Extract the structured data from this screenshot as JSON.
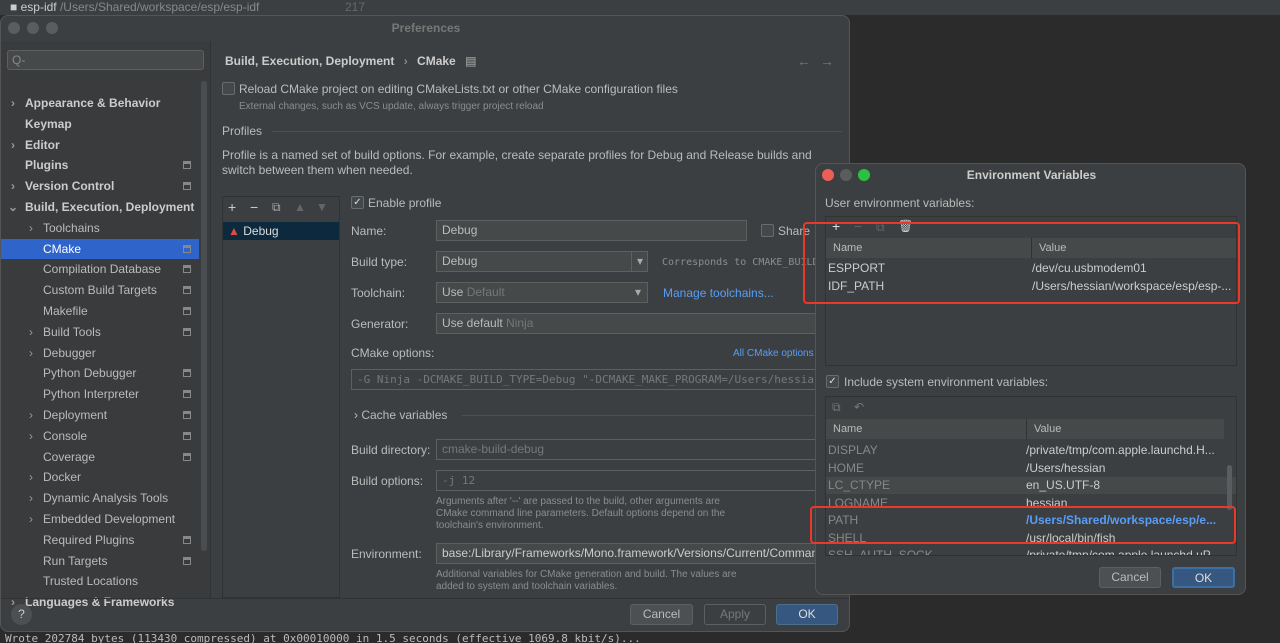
{
  "topbar": {
    "project": "esp-idf",
    "path": "/Users/Shared/workspace/esp/esp-idf",
    "line": "217"
  },
  "prefs": {
    "title": "Preferences",
    "search_placeholder": "Q-",
    "sidebar": [
      {
        "label": "Appearance & Behavior",
        "level": 0,
        "bold": true,
        "arrow": ">",
        "gear": false
      },
      {
        "label": "Keymap",
        "level": 0,
        "bold": true,
        "arrow": "",
        "gear": false
      },
      {
        "label": "Editor",
        "level": 0,
        "bold": true,
        "arrow": ">",
        "gear": false
      },
      {
        "label": "Plugins",
        "level": 0,
        "bold": true,
        "arrow": "",
        "gear": true
      },
      {
        "label": "Version Control",
        "level": 0,
        "bold": true,
        "arrow": ">",
        "gear": true
      },
      {
        "label": "Build, Execution, Deployment",
        "level": 0,
        "bold": true,
        "arrow": "v",
        "gear": false
      },
      {
        "label": "Toolchains",
        "level": 1,
        "arrow": ">",
        "gear": false
      },
      {
        "label": "CMake",
        "level": 1,
        "arrow": "",
        "gear": true,
        "selected": true
      },
      {
        "label": "Compilation Database",
        "level": 1,
        "arrow": "",
        "gear": true
      },
      {
        "label": "Custom Build Targets",
        "level": 1,
        "arrow": "",
        "gear": true
      },
      {
        "label": "Makefile",
        "level": 1,
        "arrow": "",
        "gear": true
      },
      {
        "label": "Build Tools",
        "level": 1,
        "arrow": ">",
        "gear": true
      },
      {
        "label": "Debugger",
        "level": 1,
        "arrow": ">",
        "gear": false
      },
      {
        "label": "Python Debugger",
        "level": 1,
        "arrow": "",
        "gear": true
      },
      {
        "label": "Python Interpreter",
        "level": 1,
        "arrow": "",
        "gear": true
      },
      {
        "label": "Deployment",
        "level": 1,
        "arrow": ">",
        "gear": true
      },
      {
        "label": "Console",
        "level": 1,
        "arrow": ">",
        "gear": true
      },
      {
        "label": "Coverage",
        "level": 1,
        "arrow": "",
        "gear": true
      },
      {
        "label": "Docker",
        "level": 1,
        "arrow": ">",
        "gear": false
      },
      {
        "label": "Dynamic Analysis Tools",
        "level": 1,
        "arrow": ">",
        "gear": false
      },
      {
        "label": "Embedded Development",
        "level": 1,
        "arrow": ">",
        "gear": false
      },
      {
        "label": "Required Plugins",
        "level": 1,
        "arrow": "",
        "gear": true
      },
      {
        "label": "Run Targets",
        "level": 1,
        "arrow": "",
        "gear": true
      },
      {
        "label": "Trusted Locations",
        "level": 1,
        "arrow": "",
        "gear": false
      },
      {
        "label": "Languages & Frameworks",
        "level": 0,
        "bold": true,
        "arrow": ">",
        "gear": false
      }
    ],
    "breadcrumb": {
      "parent": "Build, Execution, Deployment",
      "sep": "›",
      "current": "CMake"
    },
    "reload_label": "Reload CMake project on editing CMakeLists.txt or other CMake configuration files",
    "reload_hint": "External changes, such as VCS update, always trigger project reload",
    "profiles_heading": "Profiles",
    "profiles_desc": "Profile is a named set of build options. For example, create separate profiles for Debug and Release builds and switch between them when needed.",
    "profile_list": [
      "Debug"
    ],
    "enable_profile": "Enable profile",
    "name_label": "Name:",
    "name_value": "Debug",
    "share_label": "Share",
    "build_type_label": "Build type:",
    "build_type_value": "Debug",
    "build_type_hint": "Corresponds to CMAKE_BUILD_TYPE",
    "toolchain_label": "Toolchain:",
    "toolchain_use": "Use",
    "toolchain_value": "Default",
    "manage_toolchains": "Manage toolchains...",
    "generator_label": "Generator:",
    "generator_use": "Use default",
    "generator_value": "Ninja",
    "cmake_options_label": "CMake options:",
    "all_cmake_options": "All CMake options",
    "cmake_options_value": "-G Ninja -DCMAKE_BUILD_TYPE=Debug \"-DCMAKE_MAKE_PROGRAM=/Users/hessian",
    "cache_variables": "Cache variables",
    "build_dir_label": "Build directory:",
    "build_dir_value": "cmake-build-debug",
    "build_options_label": "Build options:",
    "build_options_value": "-j 12",
    "build_options_hint": "Arguments after '--' are passed to the build, other arguments are CMake command line parameters. Default options depend on the toolchain's environment.",
    "environment_label": "Environment:",
    "environment_value": "base:/Library/Frameworks/Mono.framework/Versions/Current/Commands",
    "environment_hint": "Additional variables for CMake generation and build. The values are added to system and toolchain variables.",
    "help": "?",
    "cancel": "Cancel",
    "apply": "Apply",
    "ok": "OK"
  },
  "env": {
    "title": "Environment Variables",
    "user_label": "User environment variables:",
    "col_name": "Name",
    "col_value": "Value",
    "user_vars": [
      {
        "name": "ESPPORT",
        "value": "/dev/cu.usbmodem01"
      },
      {
        "name": "IDF_PATH",
        "value": "/Users/hessian/workspace/esp/esp-..."
      }
    ],
    "include_system": "Include system environment variables:",
    "system_vars": [
      {
        "name": "DISPLAY",
        "value": "/private/tmp/com.apple.launchd.H..."
      },
      {
        "name": "HOME",
        "value": "/Users/hessian"
      },
      {
        "name": "LC_CTYPE",
        "value": "en_US.UTF-8"
      },
      {
        "name": "LOGNAME",
        "value": "hessian"
      },
      {
        "name": "PATH",
        "value": "/Users/Shared/workspace/esp/e...",
        "modified": true
      },
      {
        "name": "SHELL",
        "value": "/usr/local/bin/fish"
      },
      {
        "name": "SSH_AUTH_SOCK",
        "value": "/private/tmp/com.apple.launchd.uP..."
      }
    ],
    "cancel": "Cancel",
    "ok": "OK"
  },
  "console": "Wrote 202784 bytes (113430 compressed) at 0x00010000 in 1.5 seconds (effective 1069.8 kbit/s)...",
  "colors": {
    "accent": "#2f65ca",
    "link": "#589df6",
    "highlight": "#e8392a"
  }
}
